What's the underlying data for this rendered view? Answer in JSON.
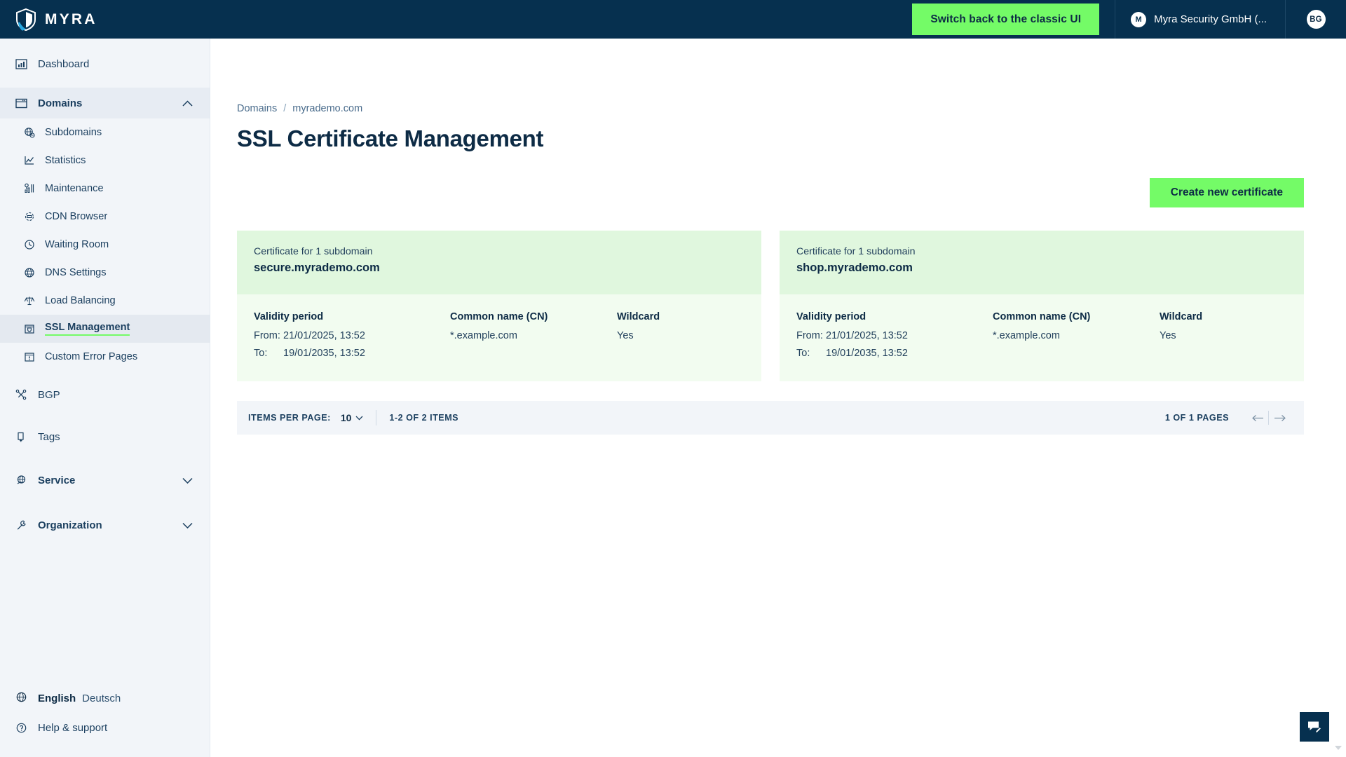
{
  "topbar": {
    "brand_name": "MYRA",
    "brand_logo_icon": "myra-shield-logo",
    "switch_label": "Switch back to the classic UI",
    "org_name": "Myra Security GmbH (...",
    "org_initial": "M",
    "user_initials": "BG"
  },
  "sidebar": {
    "dashboard": {
      "label": "Dashboard",
      "icon": "dashboard-chart-icon"
    },
    "domains": {
      "label": "Domains",
      "icon": "browser-window-icon",
      "chevron": "chevron-up-icon"
    },
    "domain_items": [
      {
        "label": "Subdomains",
        "icon": "globe-network-icon"
      },
      {
        "label": "Statistics",
        "icon": "line-chart-icon"
      },
      {
        "label": "Maintenance",
        "icon": "maintenance-bars-icon"
      },
      {
        "label": "CDN Browser",
        "icon": "cdn-refresh-icon"
      },
      {
        "label": "Waiting Room",
        "icon": "clock-icon"
      },
      {
        "label": "DNS Settings",
        "icon": "dns-globe-icon"
      },
      {
        "label": "Load Balancing",
        "icon": "scales-balance-icon"
      },
      {
        "label": "SSL Management",
        "icon": "ssl-shield-box-icon"
      },
      {
        "label": "Custom Error Pages",
        "icon": "error-page-icon"
      }
    ],
    "active_item": "SSL Management",
    "bgp": {
      "label": "BGP",
      "icon": "network-nodes-icon"
    },
    "tags": {
      "label": "Tags",
      "icon": "tag-clipboard-icon"
    },
    "service": {
      "label": "Service",
      "icon": "service-globe-icon",
      "chevron": "chevron-down-icon"
    },
    "organization": {
      "label": "Organization",
      "icon": "wrench-icon",
      "chevron": "chevron-down-icon"
    },
    "language": {
      "icon": "globe-icon",
      "english": "English",
      "deutsch": "Deutsch"
    },
    "help": {
      "label": "Help & support",
      "icon": "question-circle-icon"
    }
  },
  "main": {
    "breadcrumb": {
      "root": "Domains",
      "separator": "/",
      "current": "myrademo.com"
    },
    "title": "SSL Certificate Management",
    "create_button": "Create new certificate",
    "columns": {
      "validity": "Validity period",
      "common_name": "Common name (CN)",
      "wildcard": "Wildcard",
      "from": "From:",
      "to": "To:"
    },
    "certificates": [
      {
        "subtitle": "Certificate for 1 subdomain",
        "domain": "secure.myrademo.com",
        "valid_from": "21/01/2025, 13:52",
        "valid_to": "19/01/2035, 13:52",
        "common_name": "*.example.com",
        "wildcard": "Yes"
      },
      {
        "subtitle": "Certificate for 1 subdomain",
        "domain": "shop.myrademo.com",
        "valid_from": "21/01/2025, 13:52",
        "valid_to": "19/01/2035, 13:52",
        "common_name": "*.example.com",
        "wildcard": "Yes"
      }
    ],
    "pagination": {
      "items_per_page_label": "ITEMS PER PAGE:",
      "items_per_page_value": "10",
      "items_range": "1-2 OF 2 ITEMS",
      "pages": "1 OF 1 PAGES",
      "prev_icon": "arrow-left-icon",
      "next_icon": "arrow-right-icon",
      "chevron": "chevron-down-icon"
    },
    "chat_icon": "chat-bubble-pencil-icon"
  },
  "colors": {
    "navy": "#06304f",
    "green_accent": "#74fb67",
    "card_header": "#e0f7de",
    "card_body": "#f2fcf0",
    "sidebar_bg": "#f2f5f9"
  }
}
